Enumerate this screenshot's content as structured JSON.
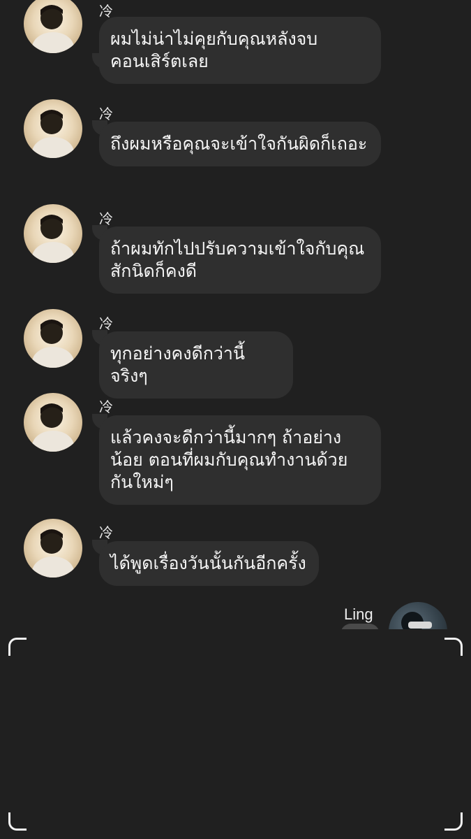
{
  "messages": [
    {
      "sender": "冷",
      "text": "ผมไม่น่าไม่คุยกับคุณหลังจบคอนเสิร์ตเลย"
    },
    {
      "sender": "冷",
      "text": "ถึงผมหรือคุณจะเข้าใจกันผิดก็เถอะ"
    },
    {
      "sender": "冷",
      "text": "ถ้าผมทักไปปรับความเข้าใจกับคุณสักนิดก็คงดี"
    },
    {
      "sender": "冷",
      "text": "ทุกอย่างคงดีกว่านี้จริงๆ"
    },
    {
      "sender": "冷",
      "text": "แล้วคงจะดีกว่านี้มากๆ ถ้าอย่างน้อย ตอนที่ผมกับคุณทำงานด้วยกันใหม่ๆ"
    },
    {
      "sender": "冷",
      "text": "ได้พูดเรื่องวันนั้นกันอีกครั้ง"
    }
  ],
  "right_user": {
    "name": "Ling"
  },
  "icons": {
    "avatar_left": "avatar-photo-icon",
    "avatar_right": "avatar-photo-icon"
  },
  "colors": {
    "background": "#202020",
    "bubble": "#2f2f2f",
    "text": "#f5f5f5"
  }
}
